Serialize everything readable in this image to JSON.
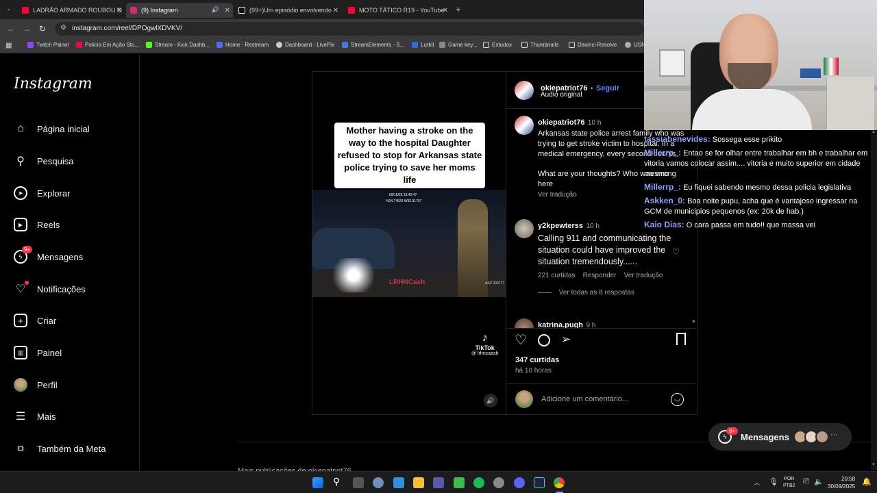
{
  "browser": {
    "tabs": [
      {
        "title": "LADRÃO ARMADO ROUBOU O",
        "color": "#ff0033"
      },
      {
        "title": "(9) Instagram",
        "color": "#d62976"
      },
      {
        "title": "(99+)Um episódio envolvendo",
        "color": "#ffffff"
      },
      {
        "title": "MOTO TÁTICO R19 - YouTube",
        "color": "#ff0033"
      }
    ],
    "new_tab_icon": "+",
    "url": "instagram.com/reel/DPOgwlXDVKV/",
    "bookmarks": [
      {
        "label": "Twitch Painel",
        "color": "#9146ff"
      },
      {
        "label": "Polícia Em Ação Stu...",
        "color": "#ff0033"
      },
      {
        "label": "Stream - Kick Dashb...",
        "color": "#53fc18"
      },
      {
        "label": "Home - Restream",
        "color": "#4a6cf7"
      },
      {
        "label": "Dashboard - LivePix",
        "color": "#cccccc"
      },
      {
        "label": "StreamElements - S...",
        "color": "#4f74e8"
      },
      {
        "label": "Lurkit",
        "color": "#2b6de6"
      },
      {
        "label": "Game key...",
        "color": "#cccccc"
      },
      {
        "label": "Estudos",
        "color": "#dcdcdc"
      },
      {
        "label": "Thumbnails",
        "color": "#dcdcdc"
      },
      {
        "label": "Davinci Resolve",
        "color": "#dcdcdc"
      },
      {
        "label": "USN",
        "color": "#cccccc"
      }
    ]
  },
  "instagram": {
    "logo": "Instagram",
    "nav": [
      {
        "label": "Página inicial",
        "icon": "home-icon"
      },
      {
        "label": "Pesquisa",
        "icon": "search-icon"
      },
      {
        "label": "Explorar",
        "icon": "compass-icon"
      },
      {
        "label": "Reels",
        "icon": "reels-icon"
      },
      {
        "label": "Mensagens",
        "icon": "messenger-icon",
        "badge": "9+"
      },
      {
        "label": "Notificações",
        "icon": "heart-icon"
      },
      {
        "label": "Criar",
        "icon": "plus-square-icon"
      },
      {
        "label": "Painel",
        "icon": "chart-icon"
      },
      {
        "label": "Perfil",
        "icon": "avatar-icon"
      },
      {
        "label": "Mais",
        "icon": "menu-icon"
      },
      {
        "label": "Também da Meta",
        "icon": "meta-icon"
      }
    ],
    "post": {
      "video_caption": "Mother having a stroke on the way to the hospital Daughter refused to stop for Arkansas state police trying to save her moms life",
      "video_stamp_date": "09/16/25 23:42:47",
      "video_stamp_coords": "N34.74523 W92.31767",
      "watermark": "LRHNCash",
      "video_corner_id": "ASP 300777",
      "tiktok_label": "TikTok",
      "tiktok_handle": "@ lrhncaash",
      "author": "okiepatriot76",
      "follow_label": "Seguir",
      "separator": "•",
      "audio": "Áudio original",
      "caption_author": "okiepatriot76",
      "caption_time": "10 h",
      "caption_text": "Arkansas state police arrest family who was trying to get stroke victim to hospital. In a medical emergency, every second counts.",
      "caption_question": "What are your thoughts? Who was wrong here",
      "translate_label": "Ver tradução",
      "comments": [
        {
          "user": "y2kpewterss",
          "time": "10 h",
          "text": "Calling 911 and communicating the situation could have improved the situation tremendously......",
          "likes": "221 curtidas",
          "reply": "Responder",
          "translate": "Ver tradução",
          "view_replies": "Ver todas as 8 respostas"
        },
        {
          "user": "katrina.pugh",
          "time": "9 h"
        }
      ],
      "likes": "347 curtidas",
      "time_ago": "há 10 horas",
      "comment_placeholder": "Adicione um comentário..."
    },
    "more_posts_label": "Mais publicações de okiepatriot76",
    "messages_pill": {
      "label": "Mensagens",
      "badge": "9+",
      "more": "···"
    }
  },
  "chat": [
    {
      "user": "tassiabenevides:",
      "text": "Sossega esse prikito"
    },
    {
      "user": "Millerrp_:",
      "text": "Entao se for olhar entre trabalhar em bh e trabalhar em vitoria vamos colocar assim.... vitoria e muito superior em cidade mesmo"
    },
    {
      "user": "Millerrp_:",
      "text": "Eu fiquei sabendo mesmo dessa policia legislativa"
    },
    {
      "user": "Askken_0:",
      "text": "Boa noite pupu, acha que é vantajoso ingressar na GCM de municipios pequenos (ex: 20k de hab.)"
    },
    {
      "user": "Kaio Dias:",
      "text": "O cara passa em tudo!! que massa vei"
    }
  ],
  "taskbar": {
    "lang": "POR",
    "layout": "PTB2",
    "time": "20:58",
    "date": "30/09/2025"
  }
}
